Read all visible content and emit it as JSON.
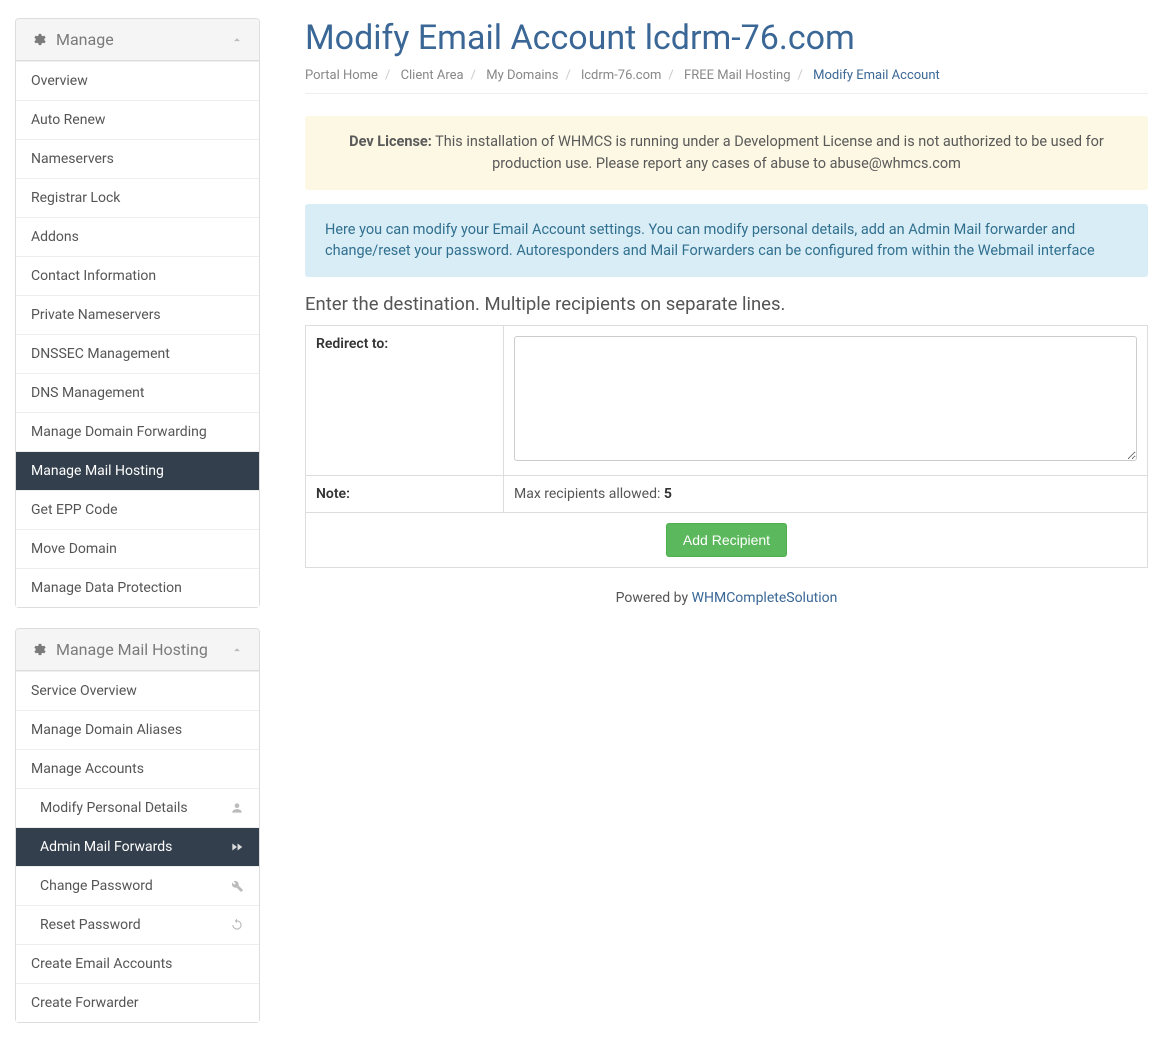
{
  "sidebar": {
    "manage": {
      "title": "Manage",
      "items": [
        {
          "label": "Overview"
        },
        {
          "label": "Auto Renew"
        },
        {
          "label": "Nameservers"
        },
        {
          "label": "Registrar Lock"
        },
        {
          "label": "Addons"
        },
        {
          "label": "Contact Information"
        },
        {
          "label": "Private Nameservers"
        },
        {
          "label": "DNSSEC Management"
        },
        {
          "label": "DNS Management"
        },
        {
          "label": "Manage Domain Forwarding"
        },
        {
          "label": "Manage Mail Hosting",
          "active": true
        },
        {
          "label": "Get EPP Code"
        },
        {
          "label": "Move Domain"
        },
        {
          "label": "Manage Data Protection"
        }
      ]
    },
    "mailhosting": {
      "title": "Manage Mail Hosting",
      "items": [
        {
          "label": "Service Overview"
        },
        {
          "label": "Manage Domain Aliases"
        },
        {
          "label": "Manage Accounts"
        },
        {
          "label": "Modify Personal Details",
          "sub": true,
          "icon": "user"
        },
        {
          "label": "Admin Mail Forwards",
          "sub": true,
          "icon": "forward",
          "active": true
        },
        {
          "label": "Change Password",
          "sub": true,
          "icon": "wrench"
        },
        {
          "label": "Reset Password",
          "sub": true,
          "icon": "refresh"
        },
        {
          "label": "Create Email Accounts"
        },
        {
          "label": "Create Forwarder"
        }
      ]
    }
  },
  "page": {
    "title": "Modify Email Account lcdrm-76.com"
  },
  "breadcrumb": [
    "Portal Home",
    "Client Area",
    "My Domains",
    "lcdrm-76.com",
    "FREE Mail Hosting",
    "Modify Email Account"
  ],
  "alerts": {
    "dev_license_bold": "Dev License:",
    "dev_license_text": " This installation of WHMCS is running under a Development License and is not authorized to be used for production use. Please report any cases of abuse to abuse@whmcs.com",
    "info_text": "Here you can modify your Email Account settings. You can modify personal details, add an Admin Mail forwarder and change/reset your password. Autoresponders and Mail Forwarders can be configured from within the Webmail interface"
  },
  "form": {
    "section_label": "Enter the destination. Multiple recipients on separate lines.",
    "redirect_label": "Redirect to:",
    "redirect_value": "",
    "note_label": "Note:",
    "note_text": "Max recipients allowed: ",
    "note_max": "5",
    "submit_label": "Add Recipient"
  },
  "footer": {
    "powered_by": "Powered by ",
    "company": "WHMCompleteSolution"
  }
}
